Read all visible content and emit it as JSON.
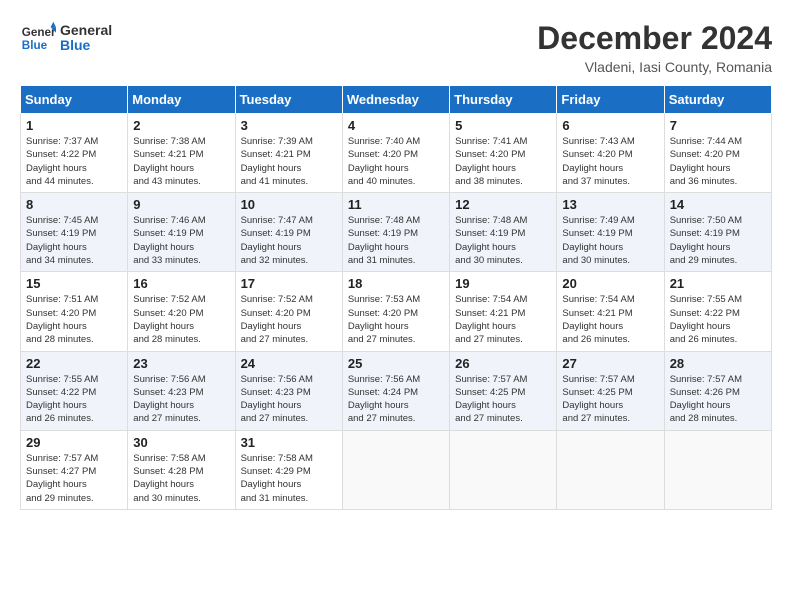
{
  "header": {
    "logo_line1": "General",
    "logo_line2": "Blue",
    "month": "December 2024",
    "location": "Vladeni, Iasi County, Romania"
  },
  "weekdays": [
    "Sunday",
    "Monday",
    "Tuesday",
    "Wednesday",
    "Thursday",
    "Friday",
    "Saturday"
  ],
  "weeks": [
    [
      {
        "day": "1",
        "sunrise": "7:37 AM",
        "sunset": "4:22 PM",
        "daylight": "8 hours and 44 minutes."
      },
      {
        "day": "2",
        "sunrise": "7:38 AM",
        "sunset": "4:21 PM",
        "daylight": "8 hours and 43 minutes."
      },
      {
        "day": "3",
        "sunrise": "7:39 AM",
        "sunset": "4:21 PM",
        "daylight": "8 hours and 41 minutes."
      },
      {
        "day": "4",
        "sunrise": "7:40 AM",
        "sunset": "4:20 PM",
        "daylight": "8 hours and 40 minutes."
      },
      {
        "day": "5",
        "sunrise": "7:41 AM",
        "sunset": "4:20 PM",
        "daylight": "8 hours and 38 minutes."
      },
      {
        "day": "6",
        "sunrise": "7:43 AM",
        "sunset": "4:20 PM",
        "daylight": "8 hours and 37 minutes."
      },
      {
        "day": "7",
        "sunrise": "7:44 AM",
        "sunset": "4:20 PM",
        "daylight": "8 hours and 36 minutes."
      }
    ],
    [
      {
        "day": "8",
        "sunrise": "7:45 AM",
        "sunset": "4:19 PM",
        "daylight": "8 hours and 34 minutes."
      },
      {
        "day": "9",
        "sunrise": "7:46 AM",
        "sunset": "4:19 PM",
        "daylight": "8 hours and 33 minutes."
      },
      {
        "day": "10",
        "sunrise": "7:47 AM",
        "sunset": "4:19 PM",
        "daylight": "8 hours and 32 minutes."
      },
      {
        "day": "11",
        "sunrise": "7:48 AM",
        "sunset": "4:19 PM",
        "daylight": "8 hours and 31 minutes."
      },
      {
        "day": "12",
        "sunrise": "7:48 AM",
        "sunset": "4:19 PM",
        "daylight": "8 hours and 30 minutes."
      },
      {
        "day": "13",
        "sunrise": "7:49 AM",
        "sunset": "4:19 PM",
        "daylight": "8 hours and 30 minutes."
      },
      {
        "day": "14",
        "sunrise": "7:50 AM",
        "sunset": "4:19 PM",
        "daylight": "8 hours and 29 minutes."
      }
    ],
    [
      {
        "day": "15",
        "sunrise": "7:51 AM",
        "sunset": "4:20 PM",
        "daylight": "8 hours and 28 minutes."
      },
      {
        "day": "16",
        "sunrise": "7:52 AM",
        "sunset": "4:20 PM",
        "daylight": "8 hours and 28 minutes."
      },
      {
        "day": "17",
        "sunrise": "7:52 AM",
        "sunset": "4:20 PM",
        "daylight": "8 hours and 27 minutes."
      },
      {
        "day": "18",
        "sunrise": "7:53 AM",
        "sunset": "4:20 PM",
        "daylight": "8 hours and 27 minutes."
      },
      {
        "day": "19",
        "sunrise": "7:54 AM",
        "sunset": "4:21 PM",
        "daylight": "8 hours and 27 minutes."
      },
      {
        "day": "20",
        "sunrise": "7:54 AM",
        "sunset": "4:21 PM",
        "daylight": "8 hours and 26 minutes."
      },
      {
        "day": "21",
        "sunrise": "7:55 AM",
        "sunset": "4:22 PM",
        "daylight": "8 hours and 26 minutes."
      }
    ],
    [
      {
        "day": "22",
        "sunrise": "7:55 AM",
        "sunset": "4:22 PM",
        "daylight": "8 hours and 26 minutes."
      },
      {
        "day": "23",
        "sunrise": "7:56 AM",
        "sunset": "4:23 PM",
        "daylight": "8 hours and 27 minutes."
      },
      {
        "day": "24",
        "sunrise": "7:56 AM",
        "sunset": "4:23 PM",
        "daylight": "8 hours and 27 minutes."
      },
      {
        "day": "25",
        "sunrise": "7:56 AM",
        "sunset": "4:24 PM",
        "daylight": "8 hours and 27 minutes."
      },
      {
        "day": "26",
        "sunrise": "7:57 AM",
        "sunset": "4:25 PM",
        "daylight": "8 hours and 27 minutes."
      },
      {
        "day": "27",
        "sunrise": "7:57 AM",
        "sunset": "4:25 PM",
        "daylight": "8 hours and 27 minutes."
      },
      {
        "day": "28",
        "sunrise": "7:57 AM",
        "sunset": "4:26 PM",
        "daylight": "8 hours and 28 minutes."
      }
    ],
    [
      {
        "day": "29",
        "sunrise": "7:57 AM",
        "sunset": "4:27 PM",
        "daylight": "8 hours and 29 minutes."
      },
      {
        "day": "30",
        "sunrise": "7:58 AM",
        "sunset": "4:28 PM",
        "daylight": "8 hours and 30 minutes."
      },
      {
        "day": "31",
        "sunrise": "7:58 AM",
        "sunset": "4:29 PM",
        "daylight": "8 hours and 31 minutes."
      },
      null,
      null,
      null,
      null
    ]
  ]
}
